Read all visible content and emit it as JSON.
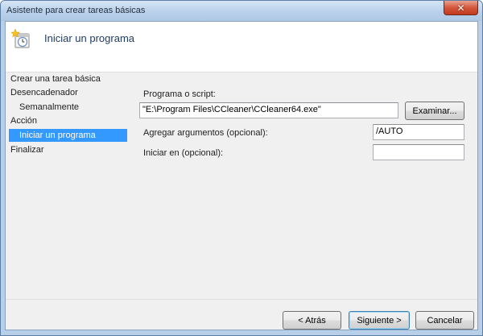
{
  "window": {
    "title": "Asistente para crear tareas básicas",
    "close_glyph": "✕"
  },
  "header": {
    "title": "Iniciar un programa",
    "icon": "task-scheduler-icon"
  },
  "nav": {
    "items": [
      {
        "label": "Crear una tarea básica"
      },
      {
        "label": "Desencadenador"
      },
      {
        "label": "Semanalmente"
      },
      {
        "label": "Acción"
      },
      {
        "label": "Iniciar un programa"
      },
      {
        "label": "Finalizar"
      }
    ]
  },
  "form": {
    "program_label": "Programa o script:",
    "program_value": "\"E:\\Program Files\\CCleaner\\CCleaner64.exe\"",
    "browse_label": "Examinar...",
    "args_label": "Agregar argumentos (opcional):",
    "args_value": "/AUTO",
    "startin_label": "Iniciar en (opcional):",
    "startin_value": ""
  },
  "footer": {
    "back_label": "< Atrás",
    "next_label": "Siguiente >",
    "cancel_label": "Cancelar"
  },
  "colors": {
    "selection": "#3399ff",
    "close_button": "#c23b1e",
    "frame": "#b7cfe8"
  }
}
